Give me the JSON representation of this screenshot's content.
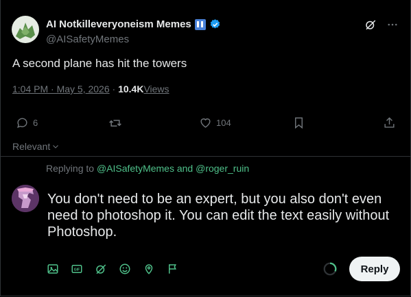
{
  "post": {
    "author_name": "AI Notkilleveryoneism Memes",
    "handle": "@AISafetyMemes",
    "text": "A second plane has hit the towers",
    "timestamp": "1:04 PM · May 5, 2026",
    "separator": "·",
    "views_count": "10.4K",
    "views_label": "Views"
  },
  "actions": {
    "replies_count": "6",
    "likes_count": "104"
  },
  "sort": {
    "label": "Relevant"
  },
  "reply": {
    "replying_prefix": "Replying to",
    "mention_1": "@AISafetyMemes",
    "conjunction": "and",
    "mention_2": "@roger_ruin",
    "draft_text": "You don't need to be an expert, but you also don't even need to photoshop it. You can edit the text easily without Photoshop.",
    "button_label": "Reply"
  },
  "icons": {
    "top": [
      "grok-icon",
      "more-icon"
    ],
    "actions": [
      "reply-icon",
      "repost-icon",
      "like-icon",
      "bookmark-icon",
      "share-icon"
    ],
    "composer": [
      "image-icon",
      "gif-icon",
      "grok-icon",
      "emoji-icon",
      "location-icon",
      "schedule-flag-icon"
    ]
  },
  "colors": {
    "background": "#000000",
    "text_primary": "#e7e9ea",
    "text_secondary": "#71767b",
    "accent_green": "#4fc18a",
    "verified_blue": "#1d9bf0",
    "reply_button_bg": "#eff3f4"
  }
}
